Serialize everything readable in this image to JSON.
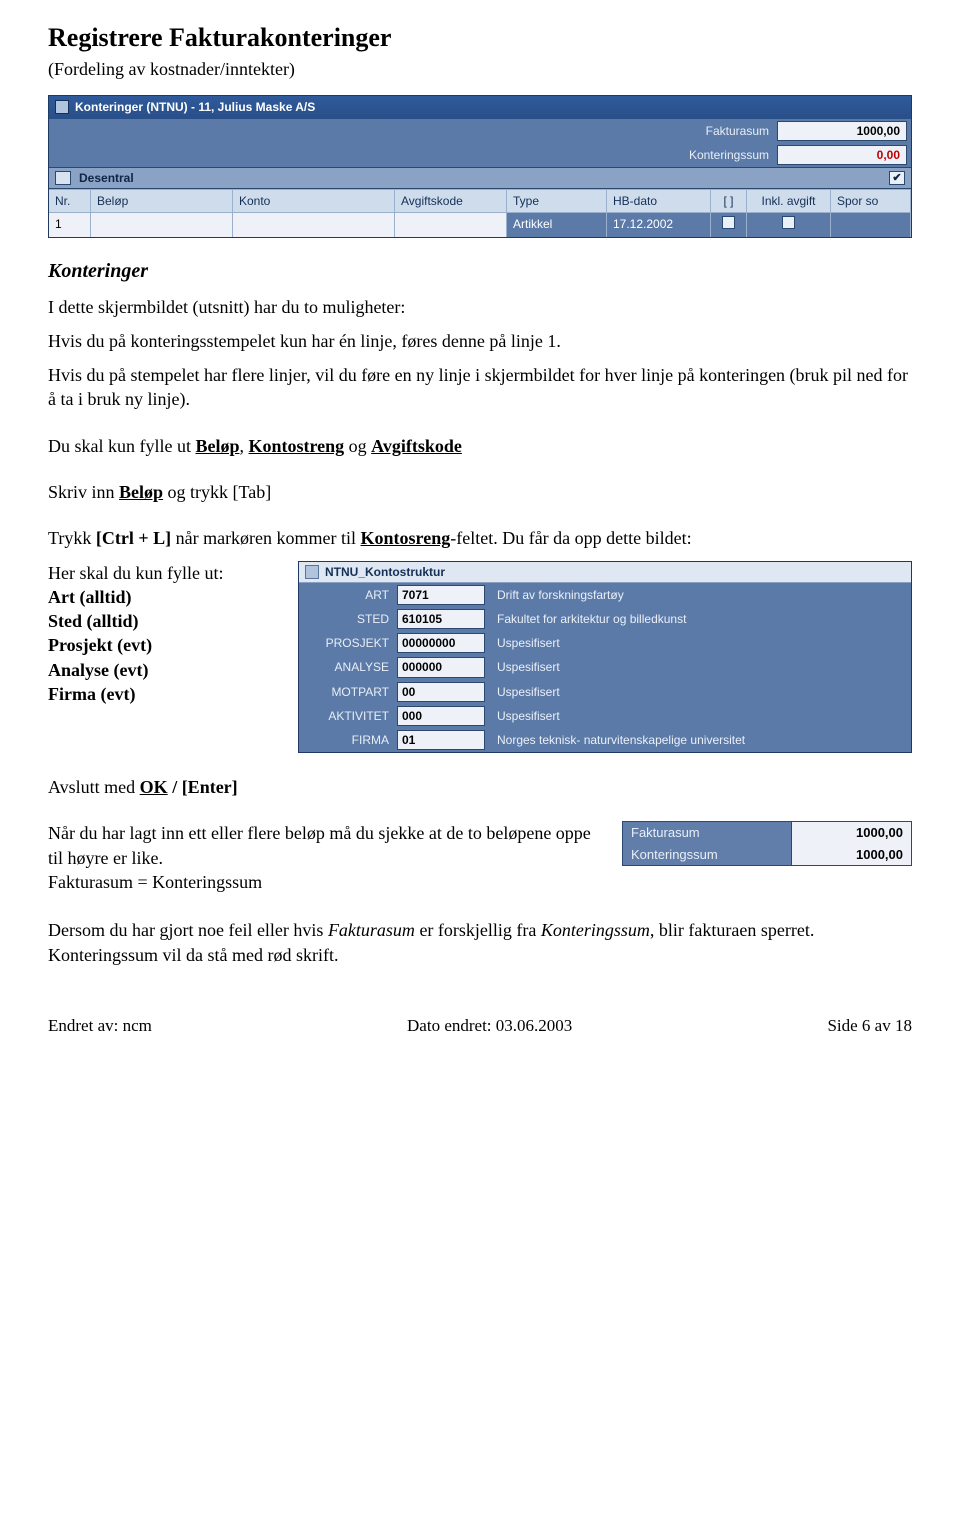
{
  "doc": {
    "title": "Registrere Fakturakonteringer",
    "subtitle": "(Fordeling av kostnader/inntekter)",
    "section_heading": "Konteringer",
    "p1": "I dette skjermbildet (utsnitt) har du to muligheter:",
    "p2": "Hvis du på konteringsstempelet kun har én linje, føres denne på linje 1.",
    "p3": "Hvis du på stempelet har flere linjer, vil du føre en ny linje i skjermbildet for hver linje på konteringen (bruk pil ned for å ta i bruk ny linje).",
    "p4_pre": "Du skal kun fylle ut ",
    "p4_b1": "Beløp",
    "p4_sep1": ",  ",
    "p4_b2": "Kontostreng",
    "p4_sep2": " og ",
    "p4_b3": "Avgiftskode",
    "p5_pre": "Skriv inn ",
    "p5_b": "Beløp",
    "p5_post": " og trykk [Tab]",
    "p6_pre": "Trykk ",
    "p6_b1": "[Ctrl + L]",
    "p6_mid": " når markøren kommer til ",
    "p6_b2": "Kontosreng",
    "p6_post": "-feltet. Du får da opp dette bildet:",
    "leftnote_line1": "Her skal du kun fylle ut:",
    "leftnote_items": [
      "Art (alltid)",
      "Sted (alltid)",
      "Prosjekt (evt)",
      "Analyse (evt)",
      "Firma (evt)"
    ],
    "p7_pre": "Avslutt med ",
    "p7_b": "OK",
    "p7_post": " / [Enter]",
    "p8a": "Når du har lagt inn ett eller flere beløp må du sjekke at de to beløpene oppe til høyre er like.",
    "p8b": "Fakturasum = Konteringssum",
    "p9a": "Dersom du har gjort noe feil eller hvis ",
    "p9_i1": "Fakturasum",
    "p9b": " er forskjellig fra ",
    "p9_i2": "Konteringssum",
    "p9c": ", blir fakturaen sperret. Konteringssum vil da stå med rød skrift.",
    "footer_left": "Endret av: ncm",
    "footer_mid": "Dato endret: 03.06.2003",
    "footer_right": "Side 6 av 18"
  },
  "shot1": {
    "title": "Konteringer (NTNU) - 11, Julius Maske A/S",
    "fakturasum_label": "Fakturasum",
    "fakturasum_value": "1000,00",
    "kontsum_label": "Konteringssum",
    "kontsum_value": "0,00",
    "group_label": "Desentral",
    "group_check": "✔",
    "headers": [
      "Nr.",
      "Beløp",
      "Konto",
      "Avgiftskode",
      "Type",
      "HB-dato",
      "[ ]",
      "Inkl. avgift",
      "Spor so"
    ],
    "row": {
      "nr": "1",
      "type": "Artikkel",
      "hb": "17.12.2002"
    }
  },
  "shot2": {
    "title": "NTNU_Kontostruktur",
    "rows": [
      {
        "label": "ART",
        "value": "7071",
        "desc": "Drift av forskningsfartøy"
      },
      {
        "label": "STED",
        "value": "610105",
        "desc": "Fakultet for arkitektur og billedkunst"
      },
      {
        "label": "PROSJEKT",
        "value": "00000000",
        "desc": "Uspesifisert"
      },
      {
        "label": "ANALYSE",
        "value": "000000",
        "desc": "Uspesifisert"
      },
      {
        "label": "MOTPART",
        "value": "00",
        "desc": "Uspesifisert"
      },
      {
        "label": "AKTIVITET",
        "value": "000",
        "desc": "Uspesifisert"
      },
      {
        "label": "FIRMA",
        "value": "01",
        "desc": "Norges teknisk- naturvitenskapelige universitet"
      }
    ]
  },
  "shot3": {
    "rows": [
      {
        "label": "Fakturasum",
        "value": "1000,00"
      },
      {
        "label": "Konteringssum",
        "value": "1000,00"
      }
    ]
  }
}
